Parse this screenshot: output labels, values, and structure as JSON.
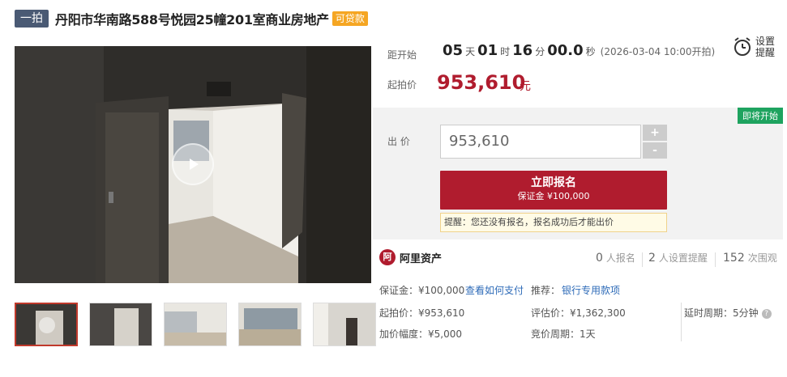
{
  "header": {
    "round_badge": "一拍",
    "title": "丹阳市华南路588号悦园25幢201室商业房地产",
    "loan_badge": "可贷款"
  },
  "countdown": {
    "label": "距开始",
    "days": "05",
    "days_unit": "天",
    "hours": "01",
    "hours_unit": "时",
    "minutes": "16",
    "minutes_unit": "分",
    "seconds": "00.0",
    "seconds_unit": "秒",
    "start_time": "(2026-03-04 10:00开拍)"
  },
  "remind": {
    "line1": "设置",
    "line2": "提醒"
  },
  "start_price": {
    "label": "起拍价",
    "value": "953,610",
    "unit": "元"
  },
  "bid": {
    "label": "出 价",
    "soon_badge": "即将开始",
    "input_value": "953,610",
    "plus": "+",
    "minus": "-",
    "signup_line1": "立即报名",
    "signup_line2": "保证金 ¥100,000",
    "tip": "提醒：您还没有报名，报名成功后才能出价"
  },
  "stats": {
    "brand": "阿里资产",
    "signups_num": "0",
    "signups_label": "人报名",
    "reminders_num": "2",
    "reminders_label": "人设置提醒",
    "views_num": "152",
    "views_label": "次围观"
  },
  "details": {
    "deposit": "保证金：¥100,000",
    "how_to_pay": "查看如何支付",
    "recommend_label": "推荐：",
    "recommend_link": "银行专用款项",
    "start_price": "起拍价：¥953,610",
    "appraisal": "评估价：¥1,362,300",
    "delay": "延时周期：5分钟",
    "increment": "加价幅度：¥5,000",
    "bid_cycle": "竞价周期：1天"
  },
  "colors": {
    "accent": "#b01c2e",
    "green": "#1ea35f",
    "navy": "#4a5a74",
    "orange": "#f5a623"
  }
}
